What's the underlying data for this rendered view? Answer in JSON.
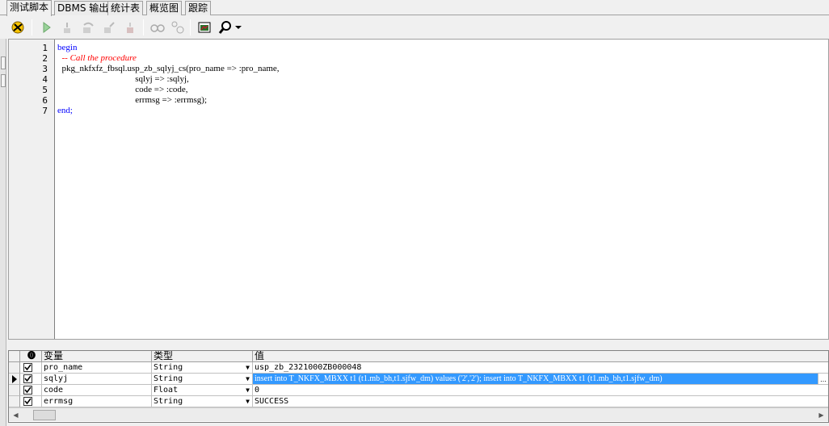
{
  "tabs": [
    "测试脚本",
    "DBMS 输出",
    "统计表",
    "概览图",
    "跟踪"
  ],
  "toolbar": {
    "icons": [
      "debug-wizard-icon",
      "run-icon",
      "step-into-icon",
      "step-over-icon",
      "step-out-icon",
      "stop-icon",
      "watch-icon",
      "breakpoint-icon",
      "window-icon",
      "find-icon",
      "dropdown-arrow-icon"
    ]
  },
  "editor": {
    "line_numbers": [
      "1",
      "2",
      "3",
      "4",
      "5",
      "6",
      "7"
    ],
    "lines": [
      {
        "parts": [
          {
            "t": "begin",
            "c": "kw"
          }
        ]
      },
      {
        "parts": [
          {
            "t": "  -- Call the procedure",
            "c": "cm"
          }
        ]
      },
      {
        "parts": [
          {
            "t": "  pkg_nkfxfz_fbsql.usp_zb_sqlyj_cs(pro_name => :pro_name,",
            "c": ""
          }
        ]
      },
      {
        "parts": [
          {
            "t": "                                   sqlyj => :sqlyj,",
            "c": ""
          }
        ]
      },
      {
        "parts": [
          {
            "t": "                                   code => :code,",
            "c": ""
          }
        ]
      },
      {
        "parts": [
          {
            "t": "                                   errmsg => :errmsg);",
            "c": ""
          }
        ]
      },
      {
        "parts": [
          {
            "t": "end;",
            "c": "kw"
          }
        ]
      }
    ]
  },
  "grid": {
    "headers": {
      "variable": "变量",
      "type": "类型",
      "value": "值"
    },
    "rows": [
      {
        "name": "pro_name",
        "type": "String",
        "value": "usp_zb_2321000ZB000048",
        "checked": true,
        "current": false,
        "selected": false
      },
      {
        "name": "sqlyj",
        "type": "String",
        "value": "insert into T_NKFX_MBXX t1 (t1.mb_bh,t1.sjfw_dm) values ('2','2'); insert into T_NKFX_MBXX t1 (t1.mb_bh,t1.sjfw_dm)",
        "checked": true,
        "current": true,
        "selected": true
      },
      {
        "name": "code",
        "type": "Float",
        "value": "0",
        "checked": true,
        "current": false,
        "selected": false
      },
      {
        "name": "errmsg",
        "type": "String",
        "value": "SUCCESS",
        "checked": true,
        "current": false,
        "selected": false
      }
    ]
  }
}
